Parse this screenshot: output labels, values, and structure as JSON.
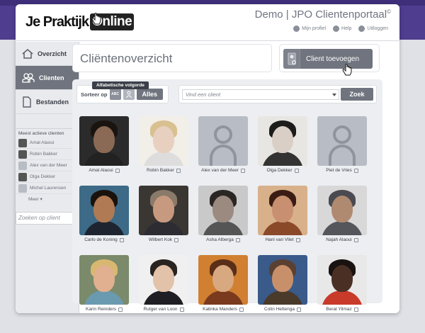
{
  "header": {
    "logo_part1": "Je Praktijk",
    "logo_part2": "Online",
    "portal_title": "Demo | JPO Clientenportaal",
    "portal_title_mark": "©",
    "links": [
      {
        "label": "Mijn profiel",
        "icon": "user-icon"
      },
      {
        "label": "Help",
        "icon": "help-icon"
      },
      {
        "label": "Uitloggen",
        "icon": "lock-icon"
      }
    ]
  },
  "sidebar": {
    "nav": [
      {
        "label": "Overzicht",
        "icon": "home-icon",
        "active": false
      },
      {
        "label": "Clienten",
        "icon": "people-icon",
        "active": true
      },
      {
        "label": "Bestanden",
        "icon": "document-icon",
        "active": false
      }
    ],
    "active_heading": "Meest actieve clienten",
    "active_clients": [
      {
        "name": "Amal Alaoui",
        "photo": true
      },
      {
        "name": "Robin Bakker",
        "photo": true
      },
      {
        "name": "Alex van der Meer",
        "photo": false
      },
      {
        "name": "Olga Dekker",
        "photo": true
      },
      {
        "name": "Michel Laurensen",
        "photo": false
      }
    ],
    "more_label": "Meer",
    "search_placeholder": "Zoeken op client"
  },
  "main": {
    "title": "Cliëntenoverzicht",
    "add_button": "Client toevoegen",
    "sort_label": "Sorteer op",
    "sort_abc": "ABC",
    "sort_all": "Alles",
    "tooltip": "Alfabetische volgorde",
    "search_placeholder": "Vind een client",
    "search_button": "Zoek"
  },
  "clients": [
    {
      "name": "Amal Alaoui",
      "skin": "#8a6a55",
      "hair": "#1a1410",
      "bg": "#2b2b2b",
      "shirt": "#222"
    },
    {
      "name": "Robin Bakker",
      "skin": "#e8d0c0",
      "hair": "#d8c090",
      "bg": "#f2eee8",
      "shirt": "#ddd"
    },
    {
      "name": "Alex van der Meer",
      "placeholder": true
    },
    {
      "name": "Olga Dekker",
      "skin": "#d9cfc6",
      "hair": "#1c1c1c",
      "bg": "#e8e6e2",
      "shirt": "#333"
    },
    {
      "name": "Piet de Vries",
      "placeholder": true
    },
    {
      "name": "Carlo de Koning",
      "skin": "#b07a55",
      "hair": "#1a120c",
      "bg": "#3d6a86",
      "shirt": "#1e2530"
    },
    {
      "name": "Wilbert Kok",
      "skin": "#c79a80",
      "hair": "#8a7a6a",
      "bg": "#3a3632",
      "shirt": "#2c2c32"
    },
    {
      "name": "Asha Alberga",
      "skin": "#9a8a80",
      "hair": "#2a2624",
      "bg": "#c9c9c9",
      "shirt": "#555"
    },
    {
      "name": "Hani van Vliet",
      "skin": "#c89070",
      "hair": "#3a1c14",
      "bg": "#d8b08a",
      "shirt": "#8a4a2a"
    },
    {
      "name": "Najah Alaoui",
      "skin": "#b08a70",
      "hair": "#4a4a50",
      "bg": "#d8d8d8",
      "shirt": "#55565c"
    },
    {
      "name": "Karin Reinders",
      "skin": "#e0b090",
      "hair": "#d8b870",
      "bg": "#7a8a6a",
      "shirt": "#6a9ab0"
    },
    {
      "name": "Rutger van Loon",
      "skin": "#e2c2a8",
      "hair": "#2a2420",
      "bg": "#f0f0f0",
      "shirt": "#1e1e24"
    },
    {
      "name": "Katinka Manders",
      "skin": "#d8a880",
      "hair": "#5a2e18",
      "bg": "#d08030",
      "shirt": "#7a3a1e"
    },
    {
      "name": "Colin Hettenga",
      "skin": "#c8906a",
      "hair": "#5a4030",
      "bg": "#3a5a8a",
      "shirt": "#4a3a2a"
    },
    {
      "name": "Berat Yilmaz",
      "skin": "#4a3024",
      "hair": "#1a1210",
      "bg": "#e8e8e8",
      "shirt": "#c83a2a"
    }
  ]
}
